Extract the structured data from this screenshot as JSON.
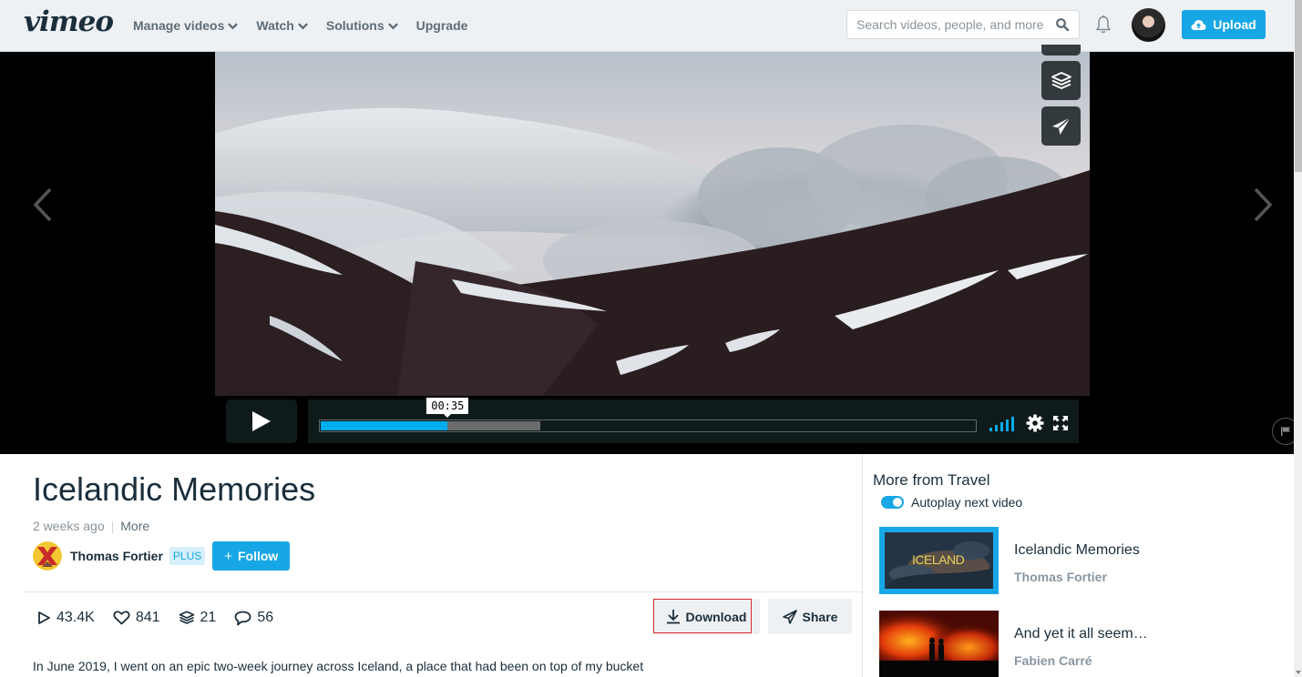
{
  "header": {
    "logo": "vimeo",
    "nav": [
      {
        "label": "Manage videos",
        "has_dropdown": true
      },
      {
        "label": "Watch",
        "has_dropdown": true
      },
      {
        "label": "Solutions",
        "has_dropdown": true
      },
      {
        "label": "Upgrade",
        "has_dropdown": false
      }
    ],
    "search": {
      "placeholder": "Search videos, people, and more",
      "value": "",
      "icon": "search-icon"
    },
    "notifications_icon": "bell-icon",
    "upload_label": "Upload",
    "upload_icon": "cloud-upload-icon",
    "accent_color": "#17a7e6"
  },
  "player": {
    "tooltip_time": "00:35",
    "played_fraction": 0.194,
    "buffered_fraction": 0.335,
    "volume_level": "high",
    "side_tools": [
      "collections-icon",
      "share-plane-icon"
    ],
    "controls": [
      "play-icon",
      "volume-icon",
      "settings-gear-icon",
      "fullscreen-icon"
    ],
    "nav_arrows": [
      "previous-video",
      "next-video"
    ],
    "progress_color": "#00adef"
  },
  "video": {
    "title": "Icelandic Memories",
    "posted": "2 weeks ago",
    "more_label": "More",
    "owner": {
      "name": "Thomas Fortier",
      "badge": "PLUS"
    },
    "follow_label": "Follow",
    "follow_prefix": "+",
    "stats": {
      "plays": "43.4K",
      "likes": "841",
      "collections": "21",
      "comments": "56"
    },
    "download_label": "Download",
    "share_label": "Share",
    "description": "In June 2019, I went on an epic two-week journey across Iceland, a place that had been on top of my bucket"
  },
  "sidebar": {
    "title": "More from Travel",
    "autoplay_label": "Autoplay next video",
    "autoplay_on": true,
    "items": [
      {
        "title": "Icelandic Memories",
        "author": "Thomas Fortier",
        "thumb_text": "ICELAND",
        "active": true
      },
      {
        "title": "And yet it all seem…",
        "author": "Fabien Carré",
        "thumb_text": "",
        "active": false
      }
    ]
  }
}
